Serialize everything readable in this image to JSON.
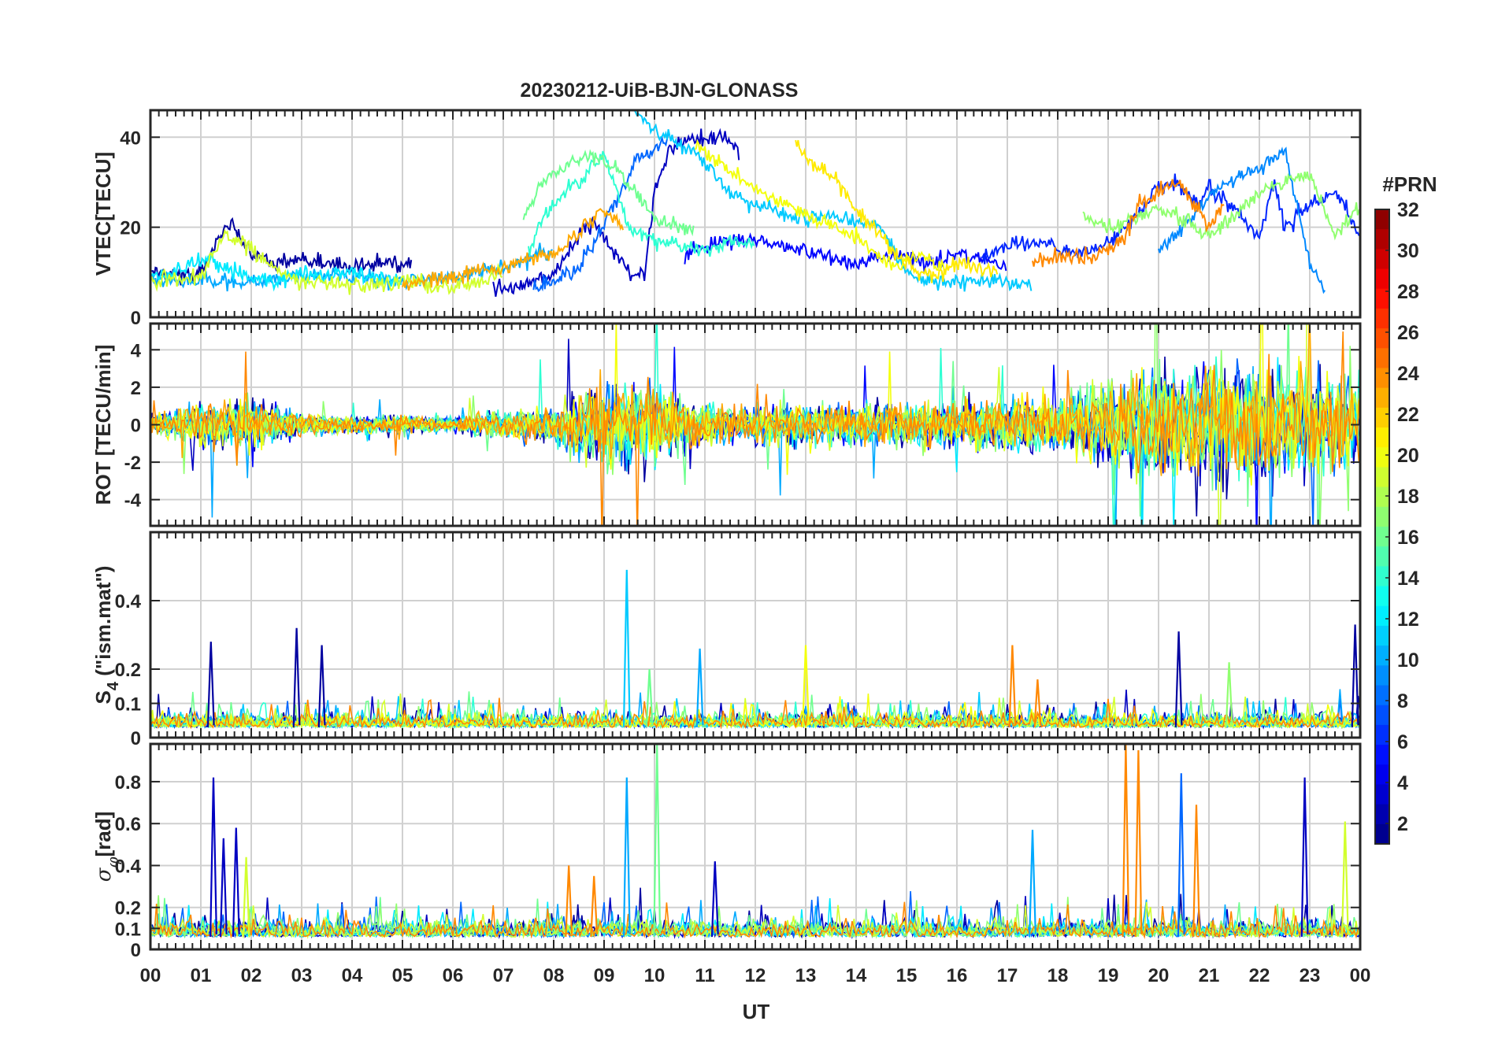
{
  "chart_data": {
    "title": "20230212-UiB-BJN-GLONASS",
    "xlabel": "UT",
    "x_ticks": [
      "00",
      "01",
      "02",
      "03",
      "04",
      "05",
      "06",
      "07",
      "08",
      "09",
      "10",
      "11",
      "12",
      "13",
      "14",
      "15",
      "16",
      "17",
      "18",
      "19",
      "20",
      "21",
      "22",
      "23",
      "00"
    ],
    "xlim_hours": [
      0,
      24
    ],
    "grid": true,
    "colorbar": {
      "label": "#PRN",
      "ticks": [
        2,
        4,
        6,
        8,
        10,
        12,
        14,
        16,
        18,
        20,
        22,
        24,
        26,
        28,
        30,
        32
      ],
      "range": [
        1,
        32
      ],
      "colormap": "jet",
      "colors": [
        "#00008f",
        "#0000ff",
        "#0080ff",
        "#00ffff",
        "#80ff80",
        "#ffff00",
        "#ff8000",
        "#ff0000",
        "#800000"
      ]
    },
    "panels": [
      {
        "name": "vtec",
        "type": "line",
        "ylabel": "VTEC[TECU]",
        "ylim": [
          0,
          46
        ],
        "yticks": [
          0,
          20,
          40
        ],
        "series": [
          {
            "prn": 2,
            "x": [
              0,
              0.5,
              1,
              1.3,
              1.6,
              2,
              2.5,
              3,
              3.5,
              4,
              4.5,
              5.2
            ],
            "y": [
              10,
              9,
              10,
              17,
              21,
              14,
              12,
              13,
              12,
              11,
              12,
              12
            ]
          },
          {
            "prn": 3,
            "x": [
              6.8,
              7.2,
              7.6,
              8,
              8.3,
              8.6,
              8.8,
              9,
              9.2,
              9.5,
              9.8,
              10,
              10.3,
              10.6,
              11,
              11.3,
              11.7
            ],
            "y": [
              6,
              7,
              8,
              10,
              15,
              20,
              21,
              18,
              14,
              10,
              9,
              28,
              37,
              39,
              40,
              41,
              37
            ]
          },
          {
            "prn": 5,
            "x": [
              10.6,
              11,
              11.5,
              12,
              12.5,
              13,
              13.5,
              14,
              14.5,
              15,
              15.5,
              16,
              16.5,
              17
            ],
            "y": [
              14,
              16,
              17,
              17,
              16,
              15,
              13,
              12,
              14,
              13,
              12,
              14,
              13,
              12
            ]
          },
          {
            "prn": 6,
            "x": [
              16.5,
              17,
              17.5,
              18,
              18.5,
              19,
              19.5,
              20,
              20.3,
              20.8,
              21,
              21.5,
              22,
              22.3,
              22.5,
              23,
              23.5,
              24
            ],
            "y": [
              14,
              16,
              17,
              15,
              14,
              16,
              22,
              29,
              30,
              25,
              29,
              24,
              18,
              30,
              20,
              25,
              28,
              18
            ]
          },
          {
            "prn": 8,
            "x": [
              7.6,
              8,
              8.4,
              8.8,
              9.2,
              9.6,
              10,
              10.3
            ],
            "y": [
              6,
              8,
              10,
              16,
              25,
              34,
              38,
              40
            ]
          },
          {
            "prn": 9,
            "x": [
              20,
              20.5,
              21,
              21.5,
              22,
              22.5,
              23,
              23.3
            ],
            "y": [
              15,
              20,
              27,
              31,
              33,
              37,
              12,
              6
            ]
          },
          {
            "prn": 10,
            "x": [
              0,
              1,
              2,
              3,
              4,
              5,
              6,
              7,
              7.5,
              8
            ],
            "y": [
              9,
              8,
              8,
              9,
              9,
              8,
              9,
              11,
              13,
              15
            ]
          },
          {
            "prn": 11,
            "x": [
              9.6,
              10,
              10.5,
              11,
              11.5,
              12,
              12.5,
              13,
              13.5,
              14,
              14.5,
              15,
              15.5,
              16,
              17,
              17.5
            ],
            "y": [
              45,
              42,
              38,
              34,
              28,
              25,
              23,
              22,
              23,
              21,
              20,
              10,
              8,
              8,
              8,
              7
            ]
          },
          {
            "prn": 12,
            "x": [
              0,
              0.5,
              1,
              1.5,
              2,
              2.5,
              3,
              3.5,
              4,
              4.5,
              5
            ],
            "y": [
              9,
              10,
              13,
              11,
              9,
              8,
              10,
              9,
              10,
              9,
              8
            ]
          },
          {
            "prn": 14,
            "x": [
              7.5,
              7.8,
              8.2,
              8.5,
              8.8,
              9,
              9.2,
              9.5,
              9.8,
              10,
              10.5,
              11,
              11.5,
              12
            ],
            "y": [
              15,
              22,
              28,
              30,
              34,
              36,
              30,
              20,
              18,
              17,
              16,
              15,
              17,
              16
            ]
          },
          {
            "prn": 16,
            "x": [
              7.4,
              7.8,
              8.2,
              8.6,
              9,
              9.2,
              9.6,
              10,
              10.4,
              10.8
            ],
            "y": [
              22,
              30,
              33,
              36,
              35,
              34,
              28,
              22,
              20,
              19
            ]
          },
          {
            "prn": 17,
            "x": [
              18.5,
              19,
              19.5,
              20,
              20.5,
              21,
              21.5,
              22,
              22.5,
              23,
              23.5,
              24
            ],
            "y": [
              22,
              20,
              22,
              24,
              22,
              18,
              22,
              28,
              30,
              32,
              18,
              25
            ]
          },
          {
            "prn": 19,
            "x": [
              0,
              1,
              1.5,
              2,
              2.5,
              3,
              4,
              5,
              6,
              7
            ],
            "y": [
              8,
              9,
              19,
              15,
              10,
              8,
              7,
              8,
              7,
              9
            ]
          },
          {
            "prn": 20,
            "x": [
              10.8,
              11.2,
              11.6,
              12,
              12.4,
              12.8,
              13.2,
              13.6,
              14,
              14.4,
              14.8,
              15.3,
              15.8
            ],
            "y": [
              38,
              35,
              32,
              28,
              26,
              24,
              22,
              20,
              18,
              14,
              12,
              14,
              10
            ]
          },
          {
            "prn": 21,
            "x": [
              12.8,
              13.2,
              13.6,
              14,
              14.4,
              14.8,
              15.2,
              15.6,
              16,
              16.4,
              16.8
            ],
            "y": [
              38,
              34,
              30,
              24,
              19,
              14,
              10,
              9,
              12,
              11,
              10
            ]
          },
          {
            "prn": 23,
            "x": [
              5,
              6,
              6.5,
              7,
              7.5,
              8,
              8.4,
              8.8,
              9,
              9.4
            ],
            "y": [
              7,
              9,
              10,
              11,
              13,
              14,
              18,
              22,
              24,
              20
            ]
          },
          {
            "prn": 24,
            "x": [
              17.5,
              18,
              18.5,
              19,
              19.3,
              19.6,
              20,
              20.3,
              20.6,
              21,
              21.3
            ],
            "y": [
              12,
              14,
              13,
              15,
              17,
              25,
              28,
              30,
              27,
              20,
              25
            ]
          }
        ]
      },
      {
        "name": "rot",
        "type": "line",
        "ylabel": "ROT [TECU/min]",
        "ylim": [
          -5.4,
          5.4
        ],
        "yticks": [
          -4,
          -2,
          0,
          2,
          4
        ],
        "activity_hours": [
          0,
          1,
          2,
          3,
          4,
          5,
          6,
          7,
          8,
          9,
          10,
          11,
          12,
          13,
          14,
          15,
          16,
          17,
          18,
          19,
          20,
          21,
          22,
          23,
          24
        ],
        "activity_envelope": [
          0.9,
          2.0,
          2.4,
          1.0,
          0.8,
          0.8,
          0.7,
          1.3,
          1.6,
          4.0,
          3.2,
          1.9,
          1.6,
          1.8,
          1.9,
          1.8,
          2.2,
          2.4,
          2.6,
          3.8,
          5.4,
          5.4,
          5.4,
          4.8,
          4.0
        ],
        "series_prns": [
          2,
          3,
          5,
          8,
          10,
          12,
          14,
          16,
          17,
          19,
          20,
          23,
          24
        ]
      },
      {
        "name": "s4",
        "type": "line",
        "ylabel": "S4 (\"ism.mat\")",
        "ylabel_main": "S",
        "ylabel_sub": "4",
        "ylabel_rest": " (\"ism.mat\")",
        "ylim": [
          0,
          0.6
        ],
        "yticks": [
          0,
          0.1,
          0.2,
          0.4
        ],
        "ytick_labels": [
          "0",
          "0.1",
          "0.2",
          "0.4"
        ],
        "peaks": [
          {
            "prn": 2,
            "x": 1.2,
            "y": 0.28
          },
          {
            "prn": 2,
            "x": 2.9,
            "y": 0.32
          },
          {
            "prn": 2,
            "x": 3.4,
            "y": 0.27
          },
          {
            "prn": 11,
            "x": 9.45,
            "y": 0.49
          },
          {
            "prn": 16,
            "x": 9.9,
            "y": 0.2
          },
          {
            "prn": 10,
            "x": 10.9,
            "y": 0.26
          },
          {
            "prn": 20,
            "x": 13.0,
            "y": 0.27
          },
          {
            "prn": 24,
            "x": 17.1,
            "y": 0.27
          },
          {
            "prn": 24,
            "x": 17.6,
            "y": 0.17
          },
          {
            "prn": 2,
            "x": 20.4,
            "y": 0.31
          },
          {
            "prn": 17,
            "x": 21.4,
            "y": 0.22
          },
          {
            "prn": 2,
            "x": 23.9,
            "y": 0.33
          }
        ],
        "series_prns": [
          2,
          3,
          8,
          10,
          11,
          14,
          16,
          17,
          19,
          20,
          24
        ]
      },
      {
        "name": "sigma_phi",
        "type": "line",
        "ylabel": "σφ[rad]",
        "ylabel_main": "σ",
        "ylabel_sub": "φ",
        "ylabel_rest": "[rad]",
        "ylim": [
          0,
          0.98
        ],
        "yticks": [
          0,
          0.1,
          0.2,
          0.4,
          0.6,
          0.8
        ],
        "ytick_labels": [
          "0",
          "0.1",
          "0.2",
          "0.4",
          "0.6",
          "0.8"
        ],
        "peaks": [
          {
            "prn": 3,
            "x": 1.25,
            "y": 0.82
          },
          {
            "prn": 3,
            "x": 1.45,
            "y": 0.53
          },
          {
            "prn": 3,
            "x": 1.7,
            "y": 0.58
          },
          {
            "prn": 19,
            "x": 1.9,
            "y": 0.44
          },
          {
            "prn": 24,
            "x": 8.3,
            "y": 0.4
          },
          {
            "prn": 24,
            "x": 8.8,
            "y": 0.35
          },
          {
            "prn": 10,
            "x": 9.45,
            "y": 0.82
          },
          {
            "prn": 16,
            "x": 10.05,
            "y": 0.98
          },
          {
            "prn": 3,
            "x": 11.2,
            "y": 0.42
          },
          {
            "prn": 10,
            "x": 17.5,
            "y": 0.57
          },
          {
            "prn": 24,
            "x": 19.35,
            "y": 0.98
          },
          {
            "prn": 24,
            "x": 19.6,
            "y": 0.95
          },
          {
            "prn": 8,
            "x": 20.45,
            "y": 0.84
          },
          {
            "prn": 24,
            "x": 20.75,
            "y": 0.69
          },
          {
            "prn": 3,
            "x": 22.9,
            "y": 0.82
          },
          {
            "prn": 19,
            "x": 23.7,
            "y": 0.61
          }
        ],
        "series_prns": [
          2,
          3,
          8,
          10,
          12,
          16,
          17,
          19,
          24
        ]
      }
    ]
  }
}
